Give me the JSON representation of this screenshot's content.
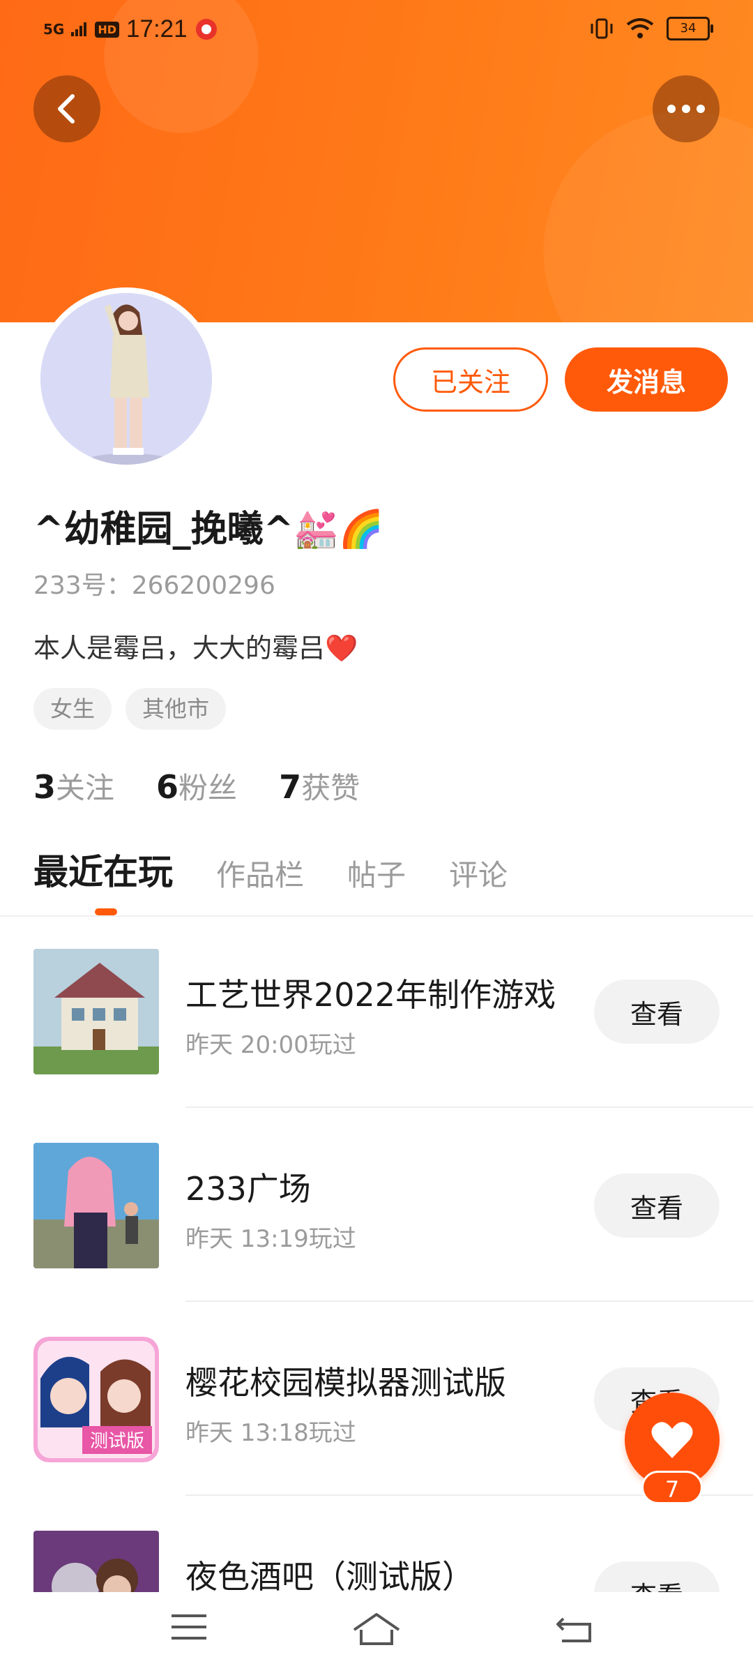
{
  "status": {
    "network": "5G",
    "hd": "HD",
    "time": "17:21",
    "battery": "34"
  },
  "profile": {
    "username": "^幼稚园_挽曦^💒🌈",
    "id_line": "233号：266200296",
    "bio": "本人是霉吕，大大的霉吕❤️",
    "tags": [
      "女生",
      "其他市"
    ],
    "follow_button": "已关注",
    "message_button": "发消息"
  },
  "stats": [
    {
      "count": "3",
      "label": "关注"
    },
    {
      "count": "6",
      "label": "粉丝"
    },
    {
      "count": "7",
      "label": "获赞"
    }
  ],
  "tabs": [
    "最近在玩",
    "作品栏",
    "帖子",
    "评论"
  ],
  "games": [
    {
      "name": "工艺世界2022年制作游戏",
      "time": "昨天 20:00玩过",
      "button": "查看"
    },
    {
      "name": "233广场",
      "time": "昨天 13:19玩过",
      "button": "查看"
    },
    {
      "name": "樱花校园模拟器测试版",
      "time": "昨天 13:18玩过",
      "button": "查看"
    },
    {
      "name": "夜色酒吧（测试版）",
      "time": "",
      "button": "查看"
    }
  ],
  "like_fab": {
    "count": "7"
  },
  "colors": {
    "accent": "#ff5a0a",
    "header": "#ff7a18"
  }
}
